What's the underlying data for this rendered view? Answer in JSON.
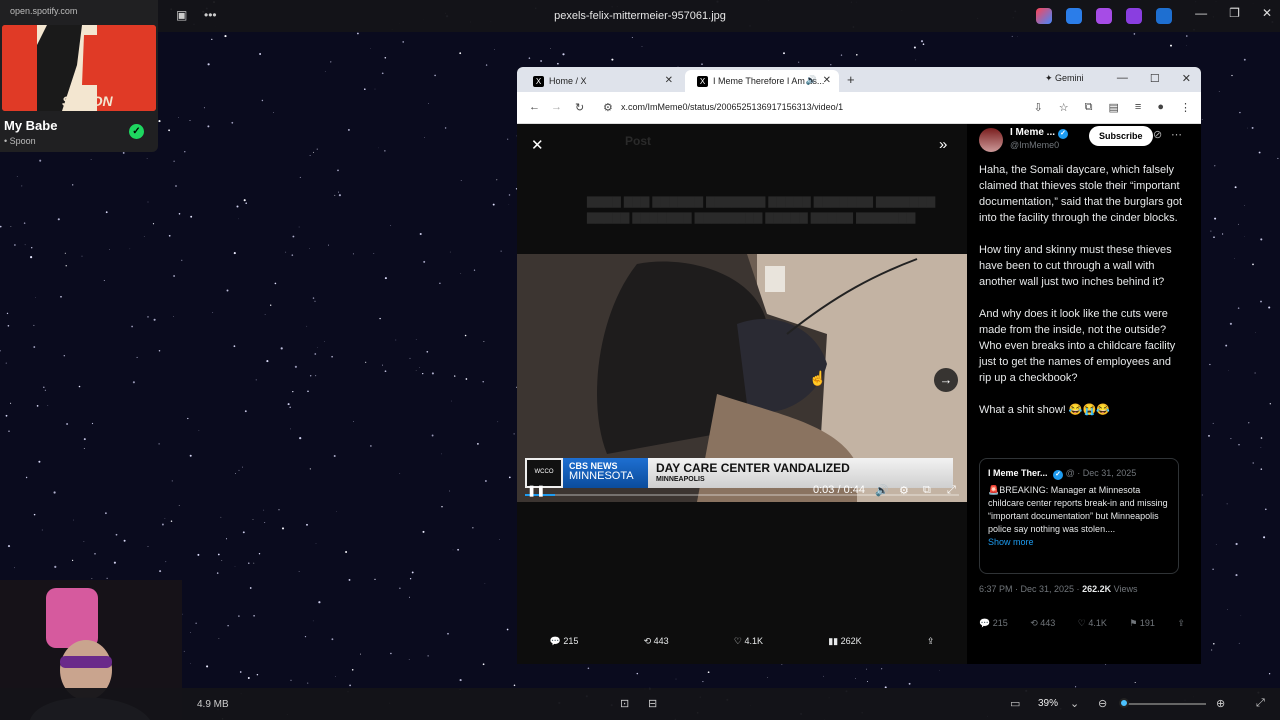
{
  "viewer": {
    "title": "pexels-felix-mittermeier-957061.jpg",
    "file_size": "4.9 MB",
    "zoom": "39%",
    "zoom_fraction": 0.05
  },
  "spotify": {
    "url": "open.spotify.com",
    "track": "My Babe",
    "artist": "• Spoon",
    "album_art_text": "SPOON"
  },
  "browser": {
    "tabs": [
      {
        "label": "Home / X",
        "active": false
      },
      {
        "label": "I Meme Therefore I Am us...",
        "active": true
      }
    ],
    "gemini_label": "Gemini",
    "url": "x.com/ImMeme0/status/2006525136917156313/video/1"
  },
  "media": {
    "lower_third": {
      "station": "WCCO",
      "network_top": "CBS NEWS",
      "network_bottom": "MINNESOTA",
      "headline": "DAY CARE CENTER VANDALIZED",
      "location": "MINNEAPOLIS"
    },
    "time": "0:03 / 0:44",
    "actions": {
      "replies": "215",
      "reposts": "443",
      "likes": "4.1K",
      "views": "262K"
    }
  },
  "tweet": {
    "author": "I Meme ...",
    "handle": "@ImMeme0",
    "subscribe_label": "Subscribe",
    "paragraphs": [
      "Haha, the Somali daycare, which falsely claimed that thieves stole their “important documentation,” said that the burglars got into the facility through the cinder blocks.",
      "How tiny and skinny must these thieves have been to cut through a wall with another wall just two inches behind it?",
      "And why does it look like the cuts were made from the inside, not the outside? Who even breaks into a childcare facility just to get the names of employees and rip up a checkbook?",
      "What a shit show! 😂😭😂"
    ],
    "quote": {
      "author": "I Meme Ther...",
      "meta": "@ · Dec 31, 2025",
      "text": "🚨BREAKING: Manager at Minnesota childcare center reports break-in and missing “important documentation” but Minneapolis police say nothing was stolen....",
      "show_more": "Show more"
    },
    "timestamp": "6:37 PM · Dec 31, 2025 ·",
    "views_count": "262.2K",
    "views_label": "Views",
    "actions": {
      "replies": "215",
      "reposts": "443",
      "likes": "4.1K",
      "bookmarks": "191"
    }
  },
  "colors": {
    "accent": "#1d9bf0",
    "spotify_green": "#1ed760",
    "cbs_blue": "#0b4c9c"
  }
}
